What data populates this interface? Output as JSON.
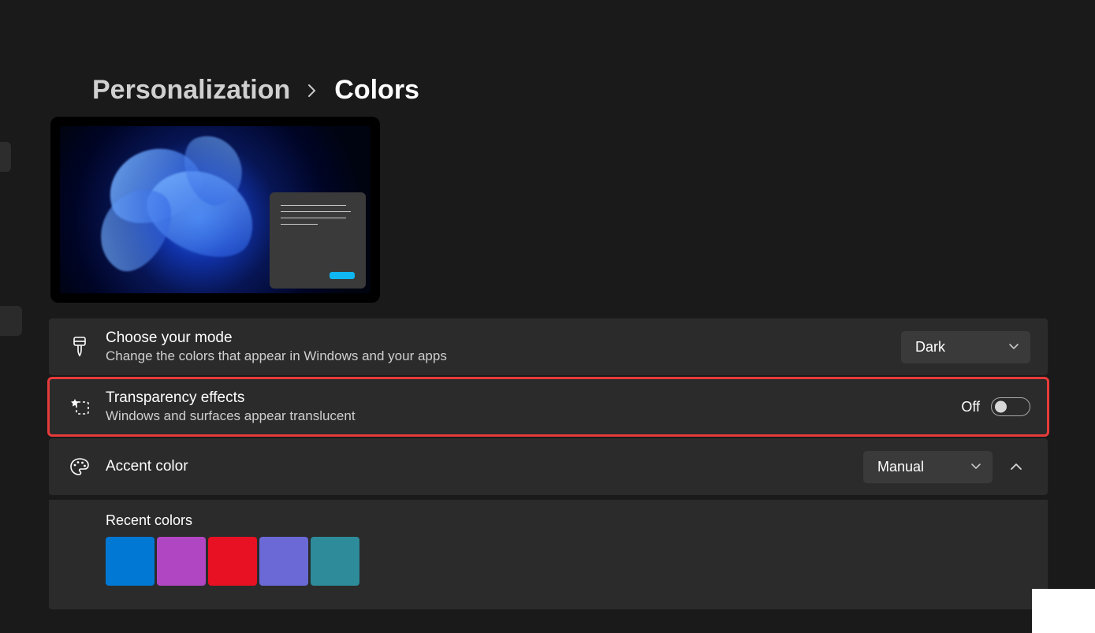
{
  "breadcrumb": {
    "parent": "Personalization",
    "current": "Colors"
  },
  "mode": {
    "title": "Choose your mode",
    "desc": "Change the colors that appear in Windows and your apps",
    "value": "Dark"
  },
  "transparency": {
    "title": "Transparency effects",
    "desc": "Windows and surfaces appear translucent",
    "stateLabel": "Off"
  },
  "accent": {
    "title": "Accent color",
    "value": "Manual"
  },
  "recent": {
    "title": "Recent colors",
    "colors": [
      "#0078d4",
      "#b146c2",
      "#e81123",
      "#6b69d6",
      "#2d8b9a"
    ]
  }
}
